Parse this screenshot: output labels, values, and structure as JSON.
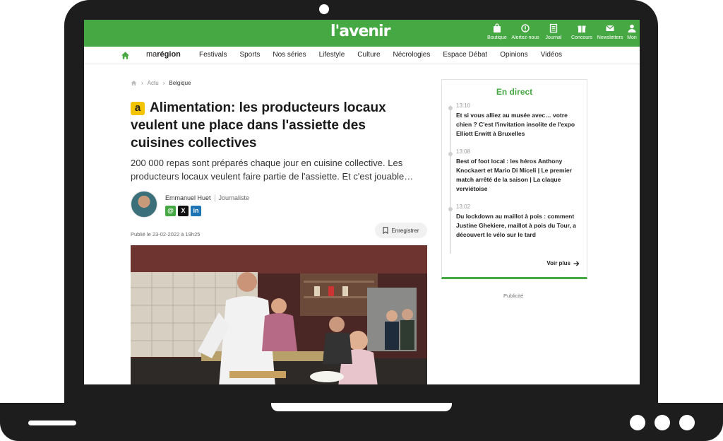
{
  "brand": {
    "logo": "l'avenir",
    "accent": "#46a843"
  },
  "toolbar": [
    {
      "label": "Boutique",
      "icon": "bag-icon"
    },
    {
      "label": "Alertez-nous",
      "icon": "alert-icon"
    },
    {
      "label": "Journal",
      "icon": "newspaper-icon"
    },
    {
      "label": "Concours",
      "icon": "gift-icon"
    },
    {
      "label": "Newsletters",
      "icon": "mail-icon"
    },
    {
      "label": "Mon",
      "icon": "user-icon"
    }
  ],
  "nav": {
    "region_prefix": "ma",
    "region_word": "région",
    "items": [
      "Festivals",
      "Sports",
      "Nos séries",
      "Lifestyle",
      "Culture",
      "Nécrologies",
      "Espace Débat",
      "Opinions",
      "Vidéos"
    ]
  },
  "breadcrumb": {
    "level1": "Actu",
    "level2": "Belgique"
  },
  "article": {
    "badge": "a",
    "title": "Alimentation: les producteurs locaux veulent une place dans l'assiette des cuisines collectives",
    "chapo": "200 000 repas sont préparés chaque jour en cuisine collective. Les producteurs locaux veulent faire partie de l'assiette. Et c'est jouable…",
    "author": "Emmanuel Huet",
    "role": "Journaliste",
    "published": "Publié le 23-02-2022 à 19h25",
    "save_label": "Enregistrer"
  },
  "live": {
    "title": "En direct",
    "entries": [
      {
        "time": "13:10",
        "headline": "Et si vous alliez au musée avec… votre chien ? C'est l'invitation insolite de l'expo Elliott Erwitt à Bruxelles"
      },
      {
        "time": "13:08",
        "headline": "Best of foot local : les héros Anthony Knockaert et Mario Di Miceli | Le premier match arrêté de la saison | La claque verviétoise"
      },
      {
        "time": "13:02",
        "headline": "Du lockdown au maillot à pois : comment Justine Ghekiere, maillot à pois du Tour, a découvert le vélo sur le tard"
      }
    ],
    "more_label": "Voir plus"
  },
  "ad_label": "Publicité"
}
